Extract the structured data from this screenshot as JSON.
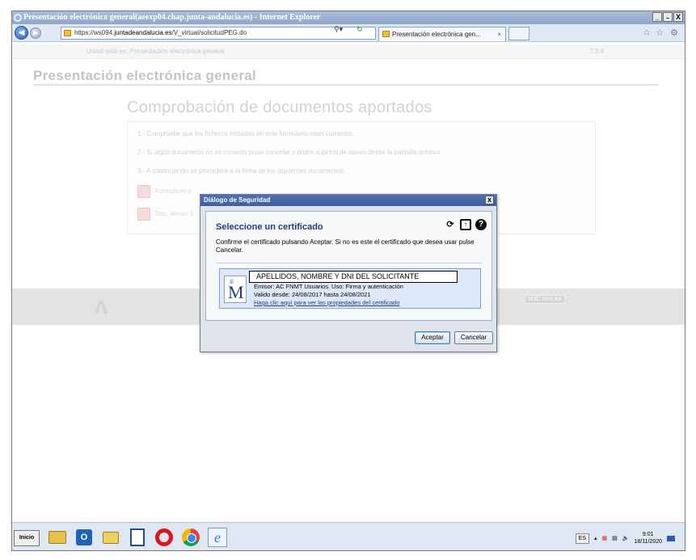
{
  "window": {
    "title": "Presentación electrónica general(aeexp04.chap.junta-andalucia.es) - Internet Explorer",
    "buttons": [
      "_",
      "̵",
      "X"
    ]
  },
  "browser": {
    "url_prefix": "https://ws094.",
    "url_host": "juntadeandalucia.es",
    "url_path": "/V_virtual/solicitudPEG.do",
    "tab_label": "Presentación electrónica gen...",
    "tab_close": "×"
  },
  "page": {
    "breadcrumb": "Usted está en: Presentación electrónica general",
    "version": "7.3.4",
    "title": "Presentación electrónica general",
    "subtitle": "Comprobación de documentos aportados",
    "steps": [
      "1.- Compruebe que los ficheros incluidos en este formulario sean correctos.",
      "2.- Si algún documento no es correcto pulse cancelar y podrá subirlos de nuevo desde la pantalla anterior.",
      "3.- A continuación se procederá a la firma de los siguientes documentos:"
    ],
    "documents": [
      "Formulario s",
      "Doc. anexo 1"
    ],
    "footer_badge": "W3C WAI-AA"
  },
  "dialog": {
    "title": "Diálogo de Seguridad",
    "close": "x",
    "heading": "Seleccione un certificado",
    "instructions": "Confirme el certificado pulsando Aceptar. Si no es este el certificado que desea usar pulse Cancelar.",
    "certificate": {
      "name": "APELLIDOS, NOMBRE Y DNI DEL SOLICITANTE",
      "issuer": "Emisor: AC FNMT Usuarios. Uso: Firma y autenticación",
      "validity": "Valido desde: 24/08/2017 hasta 24/08/2021",
      "properties_link": "Haga clic aquí para ver las propiedades del certificado"
    },
    "accept_label": "Aceptar",
    "cancel_label": "Cancelar"
  },
  "taskbar": {
    "start_label": "Inicio",
    "language": "ES",
    "time": "9:01",
    "date": "18/11/2020"
  },
  "icons": [
    "ie-icon",
    "back-icon",
    "forward-icon",
    "refresh-icon",
    "help-icon",
    "home-icon",
    "star-icon",
    "gear-icon",
    "pdf-icon",
    "fnmt-logo-icon"
  ]
}
